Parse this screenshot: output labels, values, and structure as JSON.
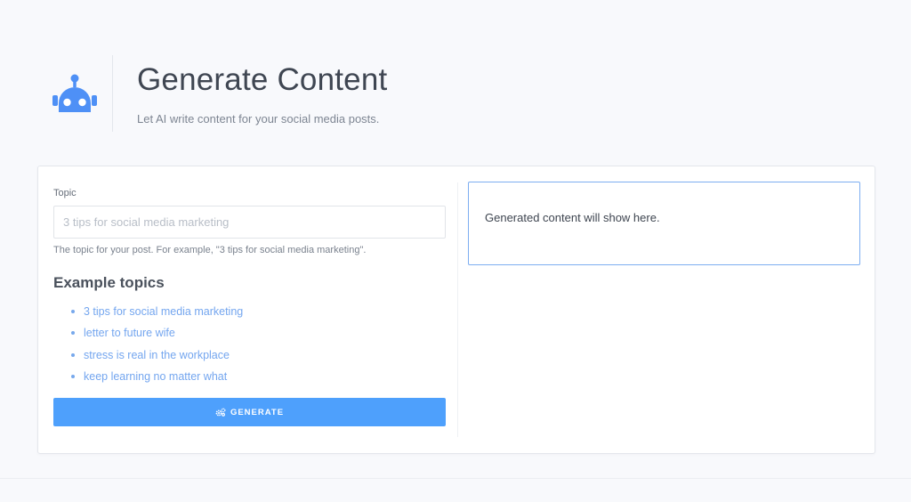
{
  "header": {
    "icon": "robot-icon",
    "title": "Generate Content",
    "subtitle": "Let AI write content for your social media posts."
  },
  "form": {
    "topic_label": "Topic",
    "topic_value": "",
    "topic_placeholder": "3 tips for social media marketing",
    "topic_help": "The topic for your post. For example, \"3 tips for social media marketing\"."
  },
  "examples": {
    "heading": "Example topics",
    "items": [
      "3 tips for social media marketing",
      "letter to future wife",
      "stress is real in the workplace",
      "keep learning no matter what"
    ]
  },
  "generate": {
    "icon": "cogs-icon",
    "label": "GENERATE"
  },
  "output": {
    "text": "Generated content will show here."
  },
  "colors": {
    "accent": "#4ea0fc",
    "link": "#74a6ef",
    "background": "#f8f9fc"
  }
}
